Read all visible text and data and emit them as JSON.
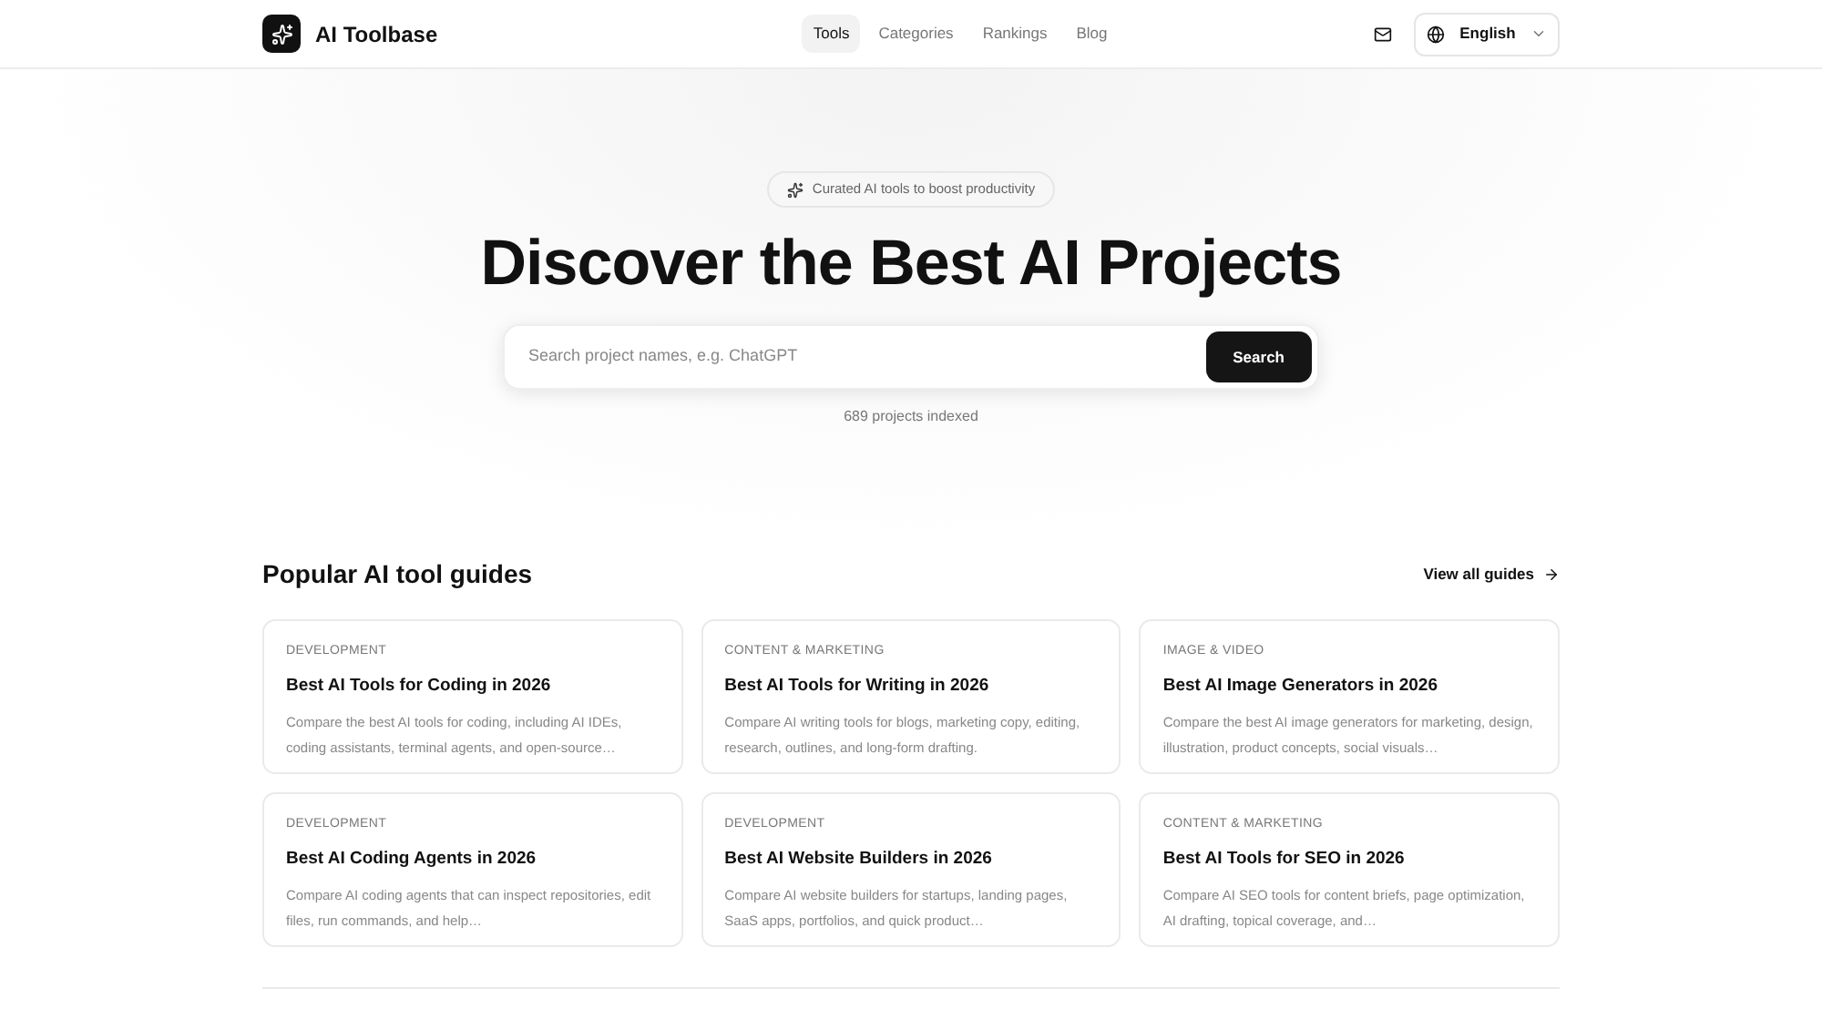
{
  "header": {
    "brand": "AI Toolbase",
    "nav": [
      {
        "label": "Tools",
        "selected": true
      },
      {
        "label": "Categories",
        "selected": false
      },
      {
        "label": "Rankings",
        "selected": false
      },
      {
        "label": "Blog",
        "selected": false
      }
    ],
    "language": "English"
  },
  "hero": {
    "badge": "Curated AI tools to boost productivity",
    "title": "Discover the Best AI Projects",
    "search": {
      "placeholder": "Search project names, e.g. ChatGPT",
      "button": "Search"
    },
    "count": "689 projects indexed"
  },
  "guides": {
    "title": "Popular AI tool guides",
    "view_all": "View all guides",
    "cards": [
      {
        "category": "DEVELOPMENT",
        "title": "Best AI Tools for Coding in 2026",
        "description": "Compare the best AI tools for coding, including AI IDEs, coding assistants, terminal agents, and open-source…"
      },
      {
        "category": "CONTENT & MARKETING",
        "title": "Best AI Tools for Writing in 2026",
        "description": "Compare AI writing tools for blogs, marketing copy, editing, research, outlines, and long-form drafting."
      },
      {
        "category": "IMAGE & VIDEO",
        "title": "Best AI Image Generators in 2026",
        "description": "Compare the best AI image generators for marketing, design, illustration, product concepts, social visuals…"
      },
      {
        "category": "DEVELOPMENT",
        "title": "Best AI Coding Agents in 2026",
        "description": "Compare AI coding agents that can inspect repositories, edit files, run commands, and help…"
      },
      {
        "category": "DEVELOPMENT",
        "title": "Best AI Website Builders in 2026",
        "description": "Compare AI website builders for startups, landing pages, SaaS apps, portfolios, and quick product…"
      },
      {
        "category": "CONTENT & MARKETING",
        "title": "Best AI Tools for SEO in 2026",
        "description": "Compare AI SEO tools for content briefs, page optimization, AI drafting, topical coverage, and…"
      }
    ]
  }
}
